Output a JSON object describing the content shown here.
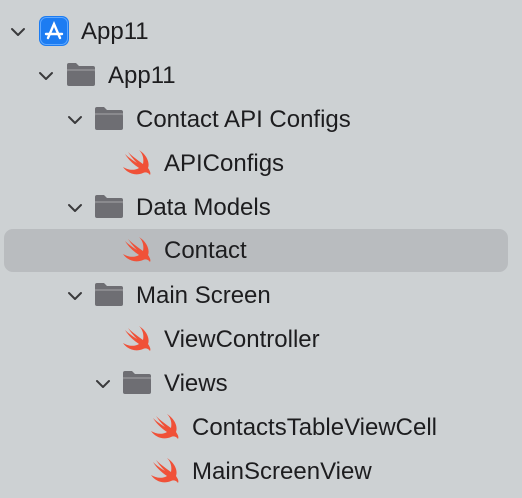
{
  "navigator": {
    "items": [
      {
        "label": "App11",
        "icon": "app-project-icon",
        "expanded": true
      },
      {
        "label": "App11",
        "icon": "folder-icon",
        "expanded": true
      },
      {
        "label": "Contact API Configs",
        "icon": "folder-icon",
        "expanded": true
      },
      {
        "label": "APIConfigs",
        "icon": "swift-file-icon"
      },
      {
        "label": "Data Models",
        "icon": "folder-icon",
        "expanded": true
      },
      {
        "label": "Contact",
        "icon": "swift-file-icon",
        "selected": true
      },
      {
        "label": "Main Screen",
        "icon": "folder-icon",
        "expanded": true
      },
      {
        "label": "ViewController",
        "icon": "swift-file-icon"
      },
      {
        "label": "Views",
        "icon": "folder-icon",
        "expanded": true
      },
      {
        "label": "ContactsTableViewCell",
        "icon": "swift-file-icon"
      },
      {
        "label": "MainScreenView",
        "icon": "swift-file-icon"
      }
    ]
  },
  "colors": {
    "background": "#cdd1d3",
    "selection": "#b9bcbf",
    "folder": "#6e6e73",
    "swift": "#f05138",
    "app_icon": "#1c7cf2"
  }
}
